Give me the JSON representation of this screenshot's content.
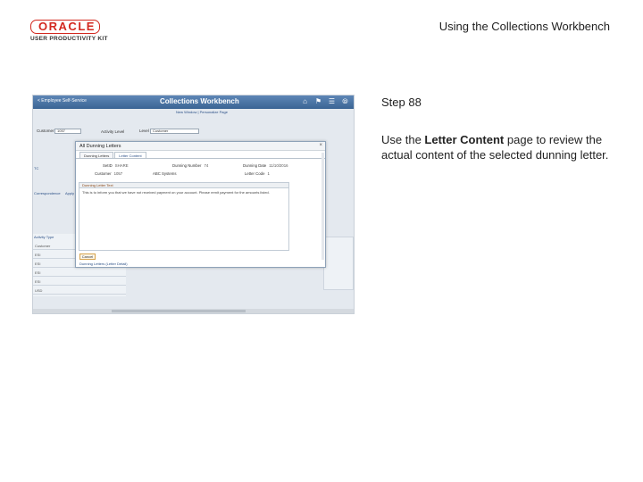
{
  "slide": {
    "header_title": "Using the Collections Workbench",
    "logo_brand": "ORACLE",
    "logo_kit": "USER PRODUCTIVITY KIT",
    "step_title": "Step 88",
    "step_text_before": "Use the ",
    "step_text_bold": "Letter Content",
    "step_text_after": " page to review the actual content of the selected dunning letter."
  },
  "screenshot": {
    "back_label": "< Employee Self-Service",
    "page_title": "Collections Workbench",
    "topbar_icons": [
      "home-icon",
      "flag-icon",
      "menu-icon",
      "compass-icon"
    ],
    "subbar_text": "New Window | Personalize Page",
    "customer_label": "Customer",
    "customer_value": "1057",
    "activity_label": "Activity Level",
    "level_label": "Level",
    "level_value": "Customer",
    "left_items": [
      "TC",
      "Correspondence",
      "Apply"
    ],
    "grid_label": "Activity Type",
    "grid_rows": [
      "Customer",
      "ESI",
      "ESI",
      "ESI",
      "ESI",
      "USD"
    ],
    "modal": {
      "title": "All Dunning Letters",
      "close_label": "×",
      "tabs": [
        "Dunning Letters",
        "Letter Content"
      ],
      "active_tab": 1,
      "fields": {
        "setid_label": "SetID",
        "setid_value": "SHARE",
        "dunning_number_label": "Dunning Number",
        "dunning_number_value": "74",
        "dunning_date_label": "Dunning Date",
        "dunning_date_value": "11/10/2016",
        "customer_label": "Customer",
        "customer_value": "1057",
        "name_label": "",
        "name_value": "ABC Systems",
        "letter_code_label": "Letter Code",
        "letter_code_value": "1"
      },
      "panel_title": "Dunning Letter Text",
      "panel_text": "This is to inform you that we have not received payment on your account. Please remit payment for the amounts listed.",
      "cancel_label": "Cancel",
      "link_label": "Dunning Letters (Letter Detail)"
    }
  }
}
